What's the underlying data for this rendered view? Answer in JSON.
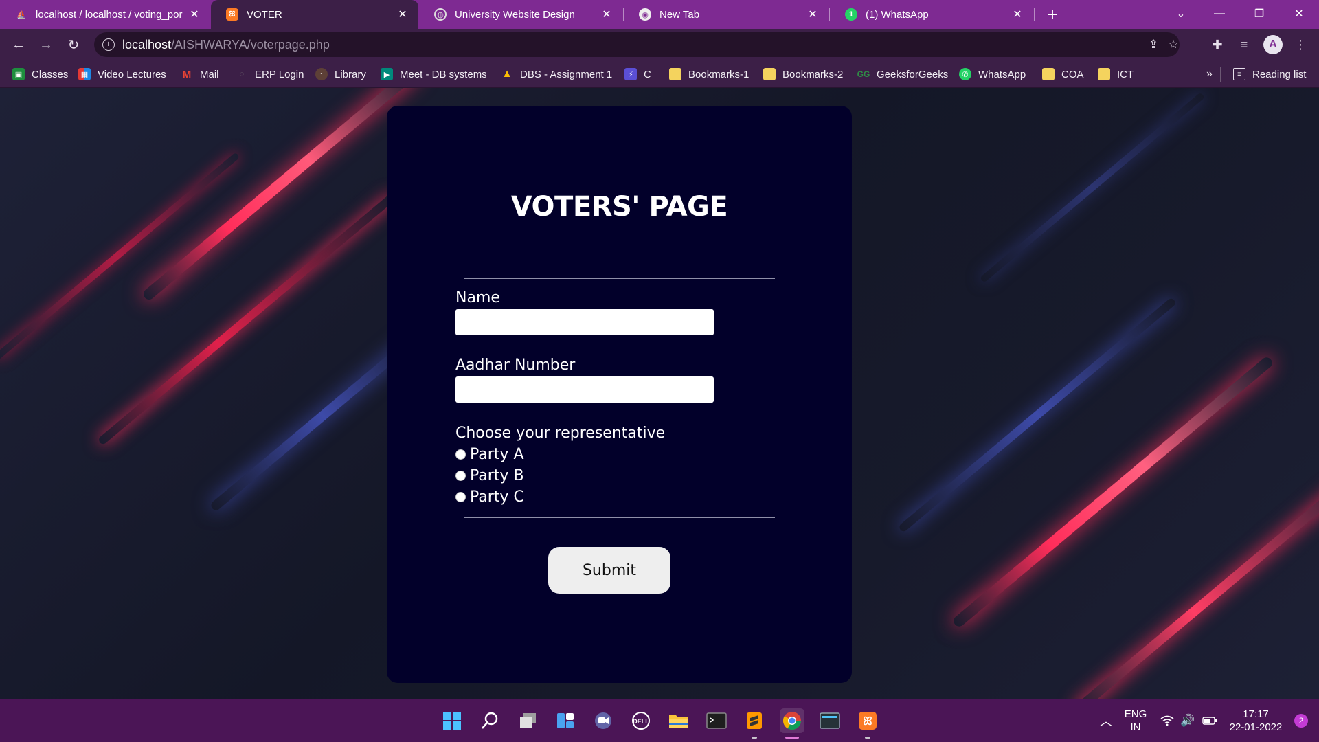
{
  "browser": {
    "tabs": [
      {
        "title": "localhost / localhost / voting_por",
        "icon": "phpmyadmin-icon",
        "active": false
      },
      {
        "title": "VOTER",
        "icon": "xampp-icon",
        "active": true
      },
      {
        "title": "University Website Design",
        "icon": "globe-icon",
        "active": false
      },
      {
        "title": "New Tab",
        "icon": "chrome-icon",
        "active": false
      },
      {
        "title": "(1) WhatsApp",
        "icon": "whatsapp-icon",
        "active": false
      }
    ],
    "url_host": "localhost",
    "url_path": "/AISHWARYA/voterpage.php",
    "bookmarks": [
      {
        "label": "Classes",
        "icon": "google-classroom-icon"
      },
      {
        "label": "Video Lectures",
        "icon": "video-lectures-icon"
      },
      {
        "label": "Mail",
        "icon": "gmail-icon"
      },
      {
        "label": "ERP Login",
        "icon": "erp-icon"
      },
      {
        "label": "Library",
        "icon": "library-icon"
      },
      {
        "label": "Meet - DB systems",
        "icon": "meet-icon"
      },
      {
        "label": "DBS - Assignment 1",
        "icon": "drive-icon"
      },
      {
        "label": "C",
        "icon": "replit-icon"
      },
      {
        "label": "Bookmarks-1",
        "icon": "folder-icon"
      },
      {
        "label": "Bookmarks-2",
        "icon": "folder-icon"
      },
      {
        "label": "GeeksforGeeks",
        "icon": "geeksforgeeks-icon"
      },
      {
        "label": "WhatsApp",
        "icon": "whatsapp-icon"
      },
      {
        "label": "COA",
        "icon": "folder-icon"
      },
      {
        "label": "ICT",
        "icon": "folder-icon"
      }
    ],
    "more_bookmarks": "»",
    "reading_list": "Reading list",
    "profile_initial": "A"
  },
  "form": {
    "title": "VOTERS' PAGE",
    "name_label": "Name",
    "name_value": "",
    "aadhar_label": "Aadhar Number",
    "aadhar_value": "",
    "choose_label": "Choose your representative",
    "parties": [
      "Party A",
      "Party B",
      "Party C"
    ],
    "submit_label": "Submit"
  },
  "taskbar": {
    "apps": [
      "windows-start-icon",
      "search-icon",
      "task-view-icon",
      "widgets-icon",
      "teams-chat-icon",
      "dell-icon",
      "file-explorer-icon",
      "terminal-icon",
      "sublime-text-icon",
      "chrome-icon",
      "mysql-workbench-icon",
      "xampp-icon"
    ],
    "lang_top": "ENG",
    "lang_bottom": "IN",
    "time": "17:17",
    "date": "22-01-2022",
    "notifications": "2"
  },
  "colors": {
    "tab_strip": "#7e2a92",
    "toolbar": "#3c1f47",
    "card": "#02002a",
    "taskbar": "#4b1556",
    "streak_red": "#ff2d5a",
    "streak_blue": "#3d4aa8"
  }
}
